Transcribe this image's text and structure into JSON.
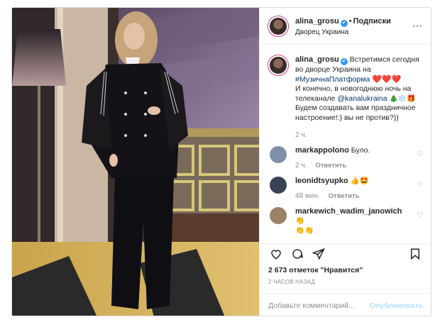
{
  "post": {
    "username": "alina_grosu",
    "verified_icon": "verified-badge-icon",
    "dot": "•",
    "follow_label": "Подписки",
    "location": "Дворец Украина",
    "more_icon": "more-options-icon"
  },
  "caption": {
    "username": "alina_grosu",
    "text_1": "Встретимся сегодня во дворце Украина на",
    "hashtag": "#МузичнаПлатформа",
    "hearts": "❤️❤️❤️",
    "text_2": "И конечно, в новогоднюю ночь на телеканале",
    "mention": "@kanalukraina",
    "emojis_1": "🎄❄️🎁",
    "text_3": "Будем создавать вам праздничное настроение!:) вы не против?))",
    "time": "2 ч."
  },
  "comments": [
    {
      "username": "markappolono",
      "text": "Було.",
      "time": "2 ч.",
      "reply": "Ответить",
      "avatar_color": "#7f8fa8"
    },
    {
      "username": "leonidtsyupko",
      "text": "👍🤩",
      "time": "48 мин.",
      "reply": "Ответить",
      "avatar_color": "#3a4256"
    },
    {
      "username": "markewich_wadim_janowich",
      "text": "👏",
      "text_2": "👏👏",
      "avatar_color": "#9a8266"
    }
  ],
  "actions": {
    "like_icon": "heart-icon",
    "comment_icon": "comment-icon",
    "share_icon": "share-icon",
    "save_icon": "bookmark-icon"
  },
  "likes": "2 673 отметок \"Нравится\"",
  "posted_ago": "2 ЧАСОВ НАЗАД",
  "add_comment": {
    "placeholder": "Добавьте комментарий...",
    "publish_label": "Опубликовать"
  },
  "colors": {
    "link": "#003569",
    "muted": "#8e8e8e",
    "publish_disabled": "#b2dffc",
    "verified": "#3897f0",
    "heart": "#ed4956"
  }
}
